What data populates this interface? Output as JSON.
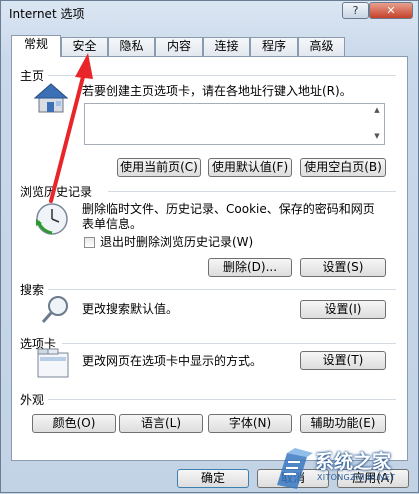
{
  "window": {
    "title": "Internet 选项",
    "help": "?",
    "close": "✕"
  },
  "tabs": [
    "常规",
    "安全",
    "隐私",
    "内容",
    "连接",
    "程序",
    "高级"
  ],
  "home": {
    "heading": "主页",
    "description": "若要创建主页选项卡，请在各地址行键入地址(R)。",
    "address_value": "",
    "buttons": [
      "使用当前页(C)",
      "使用默认值(F)",
      "使用空白页(B)"
    ]
  },
  "history": {
    "heading": "浏览历史记录",
    "description": "删除临时文件、历史记录、Cookie、保存的密码和网页表单信息。",
    "checkbox_label": "退出时删除浏览历史记录(W)",
    "checkbox_checked": false,
    "buttons": [
      "删除(D)...",
      "设置(S)"
    ]
  },
  "search": {
    "heading": "搜索",
    "description": "更改搜索默认值。",
    "button": "设置(I)"
  },
  "tabs_section": {
    "heading": "选项卡",
    "description": "更改网页在选项卡中显示的方式。",
    "button": "设置(T)"
  },
  "appearance": {
    "heading": "外观",
    "buttons": [
      "颜色(O)",
      "语言(L)",
      "字体(N)",
      "辅助功能(E)"
    ]
  },
  "footer": {
    "buttons": [
      "确定",
      "取消",
      "应用(A)"
    ]
  },
  "watermark": {
    "brand": "系统之家",
    "url": "XITONGZHIJIA.NET"
  },
  "colors": {
    "arrow": "#e8262a",
    "accent": "#3a78c2"
  }
}
